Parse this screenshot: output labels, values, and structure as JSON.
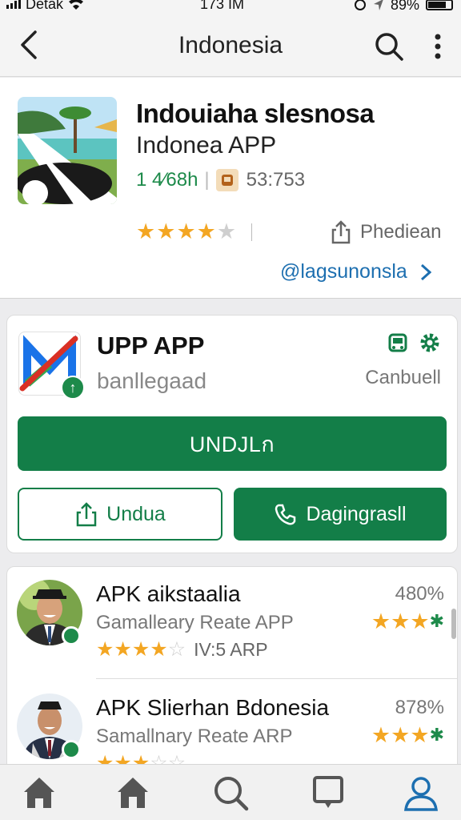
{
  "status": {
    "carrier": "Detak",
    "time": "173 IM",
    "battery": "89%"
  },
  "header": {
    "title": "Indonesia"
  },
  "hero": {
    "name": "Indouiaha slesnosa",
    "subtitle": "Indonea APP",
    "size": "1 4⁄68h",
    "count": "53:753",
    "rating": 4,
    "share_label": "Phediean",
    "link": "@lagsunonsla"
  },
  "app": {
    "name": "UPP APP",
    "developer": "banllegaad",
    "category": "Canbuell",
    "primary_button": "UNDJLก",
    "secondary_button": "Undua",
    "call_button": "Dagingrasll"
  },
  "list": {
    "items": [
      {
        "title": "APK aikstaalia",
        "desc": "Gamalleary Reate APP",
        "rating": 4,
        "meta": "IV:5 ARP",
        "pct": "480%"
      },
      {
        "title": "APK Slierhan Bdonesia",
        "desc": "Samallnary Reate ARP",
        "rating": 3,
        "meta": "",
        "pct": "878%"
      }
    ]
  },
  "colors": {
    "accent": "#137e48",
    "star": "#f3a623",
    "link": "#1d6fb0"
  }
}
